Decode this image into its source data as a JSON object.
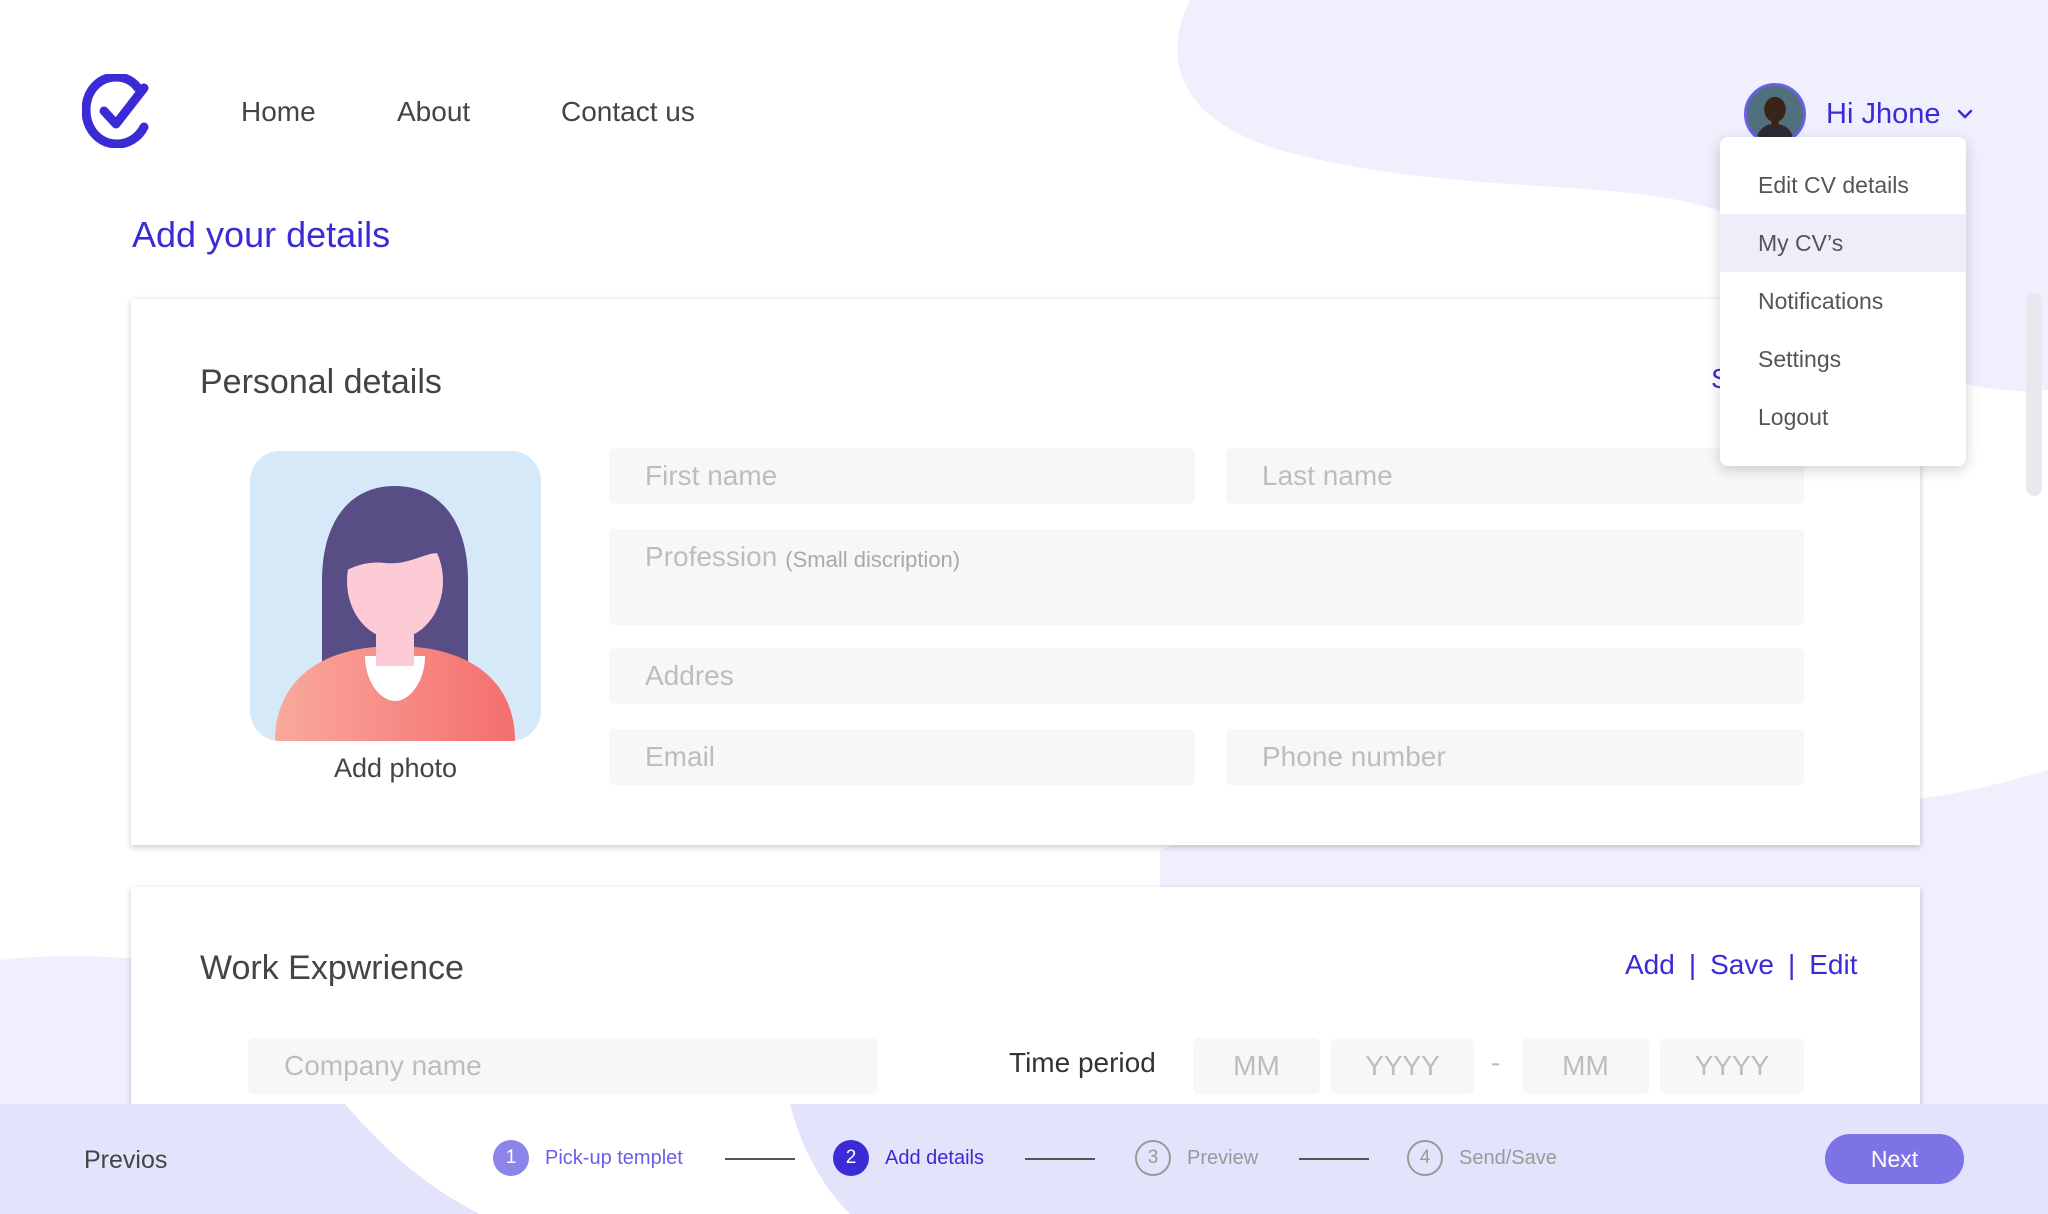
{
  "header": {
    "nav": [
      "Home",
      "About",
      "Contact us"
    ],
    "user_greeting": "Hi Jhone"
  },
  "dropdown": {
    "items": [
      "Edit CV details",
      "My CV’s",
      "Notifications",
      "Settings",
      "Logout"
    ],
    "active_index": 1
  },
  "page": {
    "title": "Add your details"
  },
  "personal": {
    "title": "Personal details",
    "partial_link": "S",
    "add_photo": "Add photo",
    "placeholders": {
      "first_name": "First name",
      "last_name": "Last name",
      "profession": "Profession",
      "profession_hint": "(Small discription)",
      "address": "Addres",
      "email": "Email",
      "phone": "Phone number"
    }
  },
  "work": {
    "title": "Work Expwrience",
    "actions": [
      "Add",
      "|",
      "Save",
      "|",
      "Edit"
    ],
    "company_placeholder": "Company name",
    "time_label": "Time period",
    "date_fields": [
      "MM",
      "YYYY",
      "MM",
      "YYYY"
    ],
    "date_separator": "-"
  },
  "footer": {
    "previous": "Previos",
    "next": "Next",
    "steps": [
      {
        "num": "1",
        "label": "Pick-up templet",
        "state": "done"
      },
      {
        "num": "2",
        "label": "Add details",
        "state": "current"
      },
      {
        "num": "3",
        "label": "Preview",
        "state": "upcoming"
      },
      {
        "num": "4",
        "label": "Send/Save",
        "state": "upcoming"
      }
    ]
  },
  "colors": {
    "accent": "#3a2bd6",
    "accent_soft": "#7b73e6",
    "bg_blob": "#efeffd",
    "footer_bg": "#e3e3fb"
  }
}
